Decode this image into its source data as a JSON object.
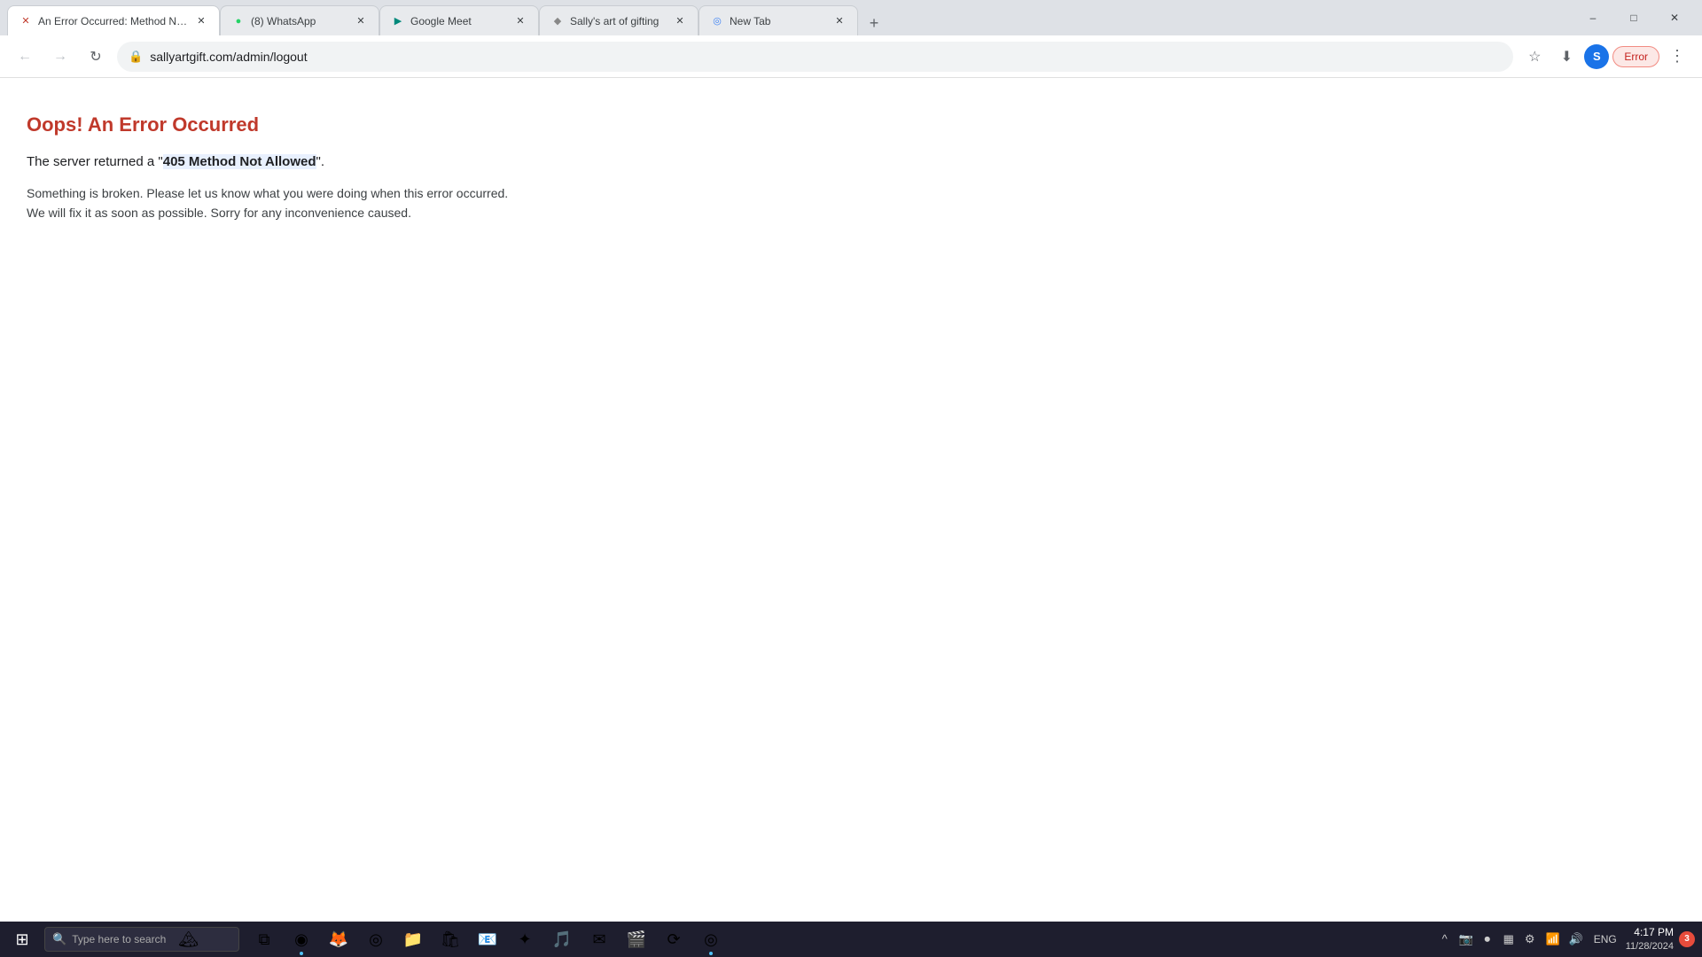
{
  "titlebar": {
    "tabs": [
      {
        "id": "error-tab",
        "title": "An Error Occurred: Method No...",
        "favicon": "✕",
        "favicon_class": "favicon-error",
        "active": true,
        "closable": true
      },
      {
        "id": "whatsapp-tab",
        "title": "(8) WhatsApp",
        "favicon": "●",
        "favicon_class": "favicon-whatsapp",
        "active": false,
        "closable": true
      },
      {
        "id": "meet-tab",
        "title": "Google Meet",
        "favicon": "▶",
        "favicon_class": "favicon-meet",
        "active": false,
        "closable": true
      },
      {
        "id": "sally-tab",
        "title": "Sally's art of gifting",
        "favicon": "◆",
        "favicon_class": "favicon-sally",
        "active": false,
        "closable": true
      },
      {
        "id": "newtab-tab",
        "title": "New Tab",
        "favicon": "◎",
        "favicon_class": "favicon-newtab",
        "active": false,
        "closable": true
      }
    ],
    "new_tab_label": "+",
    "minimize_label": "–",
    "restore_label": "□",
    "close_label": "✕"
  },
  "navbar": {
    "back_title": "Back",
    "forward_title": "Forward",
    "reload_title": "Reload",
    "url": "sallyartgift.com/admin/logout",
    "bookmark_title": "Bookmark",
    "download_title": "Download",
    "profile_letter": "S",
    "error_badge": "Error",
    "menu_title": "More options"
  },
  "page": {
    "title": "Oops! An Error Occurred",
    "subtitle_prefix": "The server returned a \"",
    "subtitle_highlight": "405 Method Not Allowed",
    "subtitle_suffix": "\".",
    "body": "Something is broken. Please let us know what you were doing when this error occurred. We will fix it as soon as possible. Sorry for any inconvenience caused."
  },
  "taskbar": {
    "start_icon": "⊞",
    "search_placeholder": "Type here to search",
    "search_icon": "🔍",
    "apps": [
      {
        "id": "task-view",
        "icon": "⧉",
        "label": "Task View",
        "active": false
      },
      {
        "id": "edge",
        "icon": "◉",
        "label": "Microsoft Edge",
        "active": true
      },
      {
        "id": "firefox",
        "icon": "🦊",
        "label": "Firefox",
        "active": false
      },
      {
        "id": "chrome",
        "icon": "◎",
        "label": "Chrome",
        "active": false
      },
      {
        "id": "file-explorer",
        "icon": "📁",
        "label": "File Explorer",
        "active": false
      },
      {
        "id": "store",
        "icon": "🏪",
        "label": "Microsoft Store",
        "active": false
      },
      {
        "id": "outlook",
        "icon": "📧",
        "label": "Outlook",
        "active": false
      },
      {
        "id": "copilot",
        "icon": "✦",
        "label": "Copilot",
        "active": false
      },
      {
        "id": "vlc",
        "icon": "▶",
        "label": "VLC",
        "active": false
      },
      {
        "id": "mail",
        "icon": "✉",
        "label": "Mail",
        "active": false
      },
      {
        "id": "claquette",
        "icon": "🎬",
        "label": "Claquette",
        "active": false
      },
      {
        "id": "bittorrent",
        "icon": "⟳",
        "label": "BitTorrent",
        "active": false
      },
      {
        "id": "chrome2",
        "icon": "◎",
        "label": "Chrome",
        "active": true
      }
    ],
    "tray": {
      "show_hidden": "^",
      "camera": "📷",
      "recorder": "⏺",
      "system_tray": "▦",
      "settings_tray": "⚙",
      "wifi": "📶",
      "volume": "🔊",
      "lang": "ENG"
    },
    "clock": {
      "time": "4:17 PM",
      "date": "11/28/2024"
    },
    "notification_count": "3"
  }
}
